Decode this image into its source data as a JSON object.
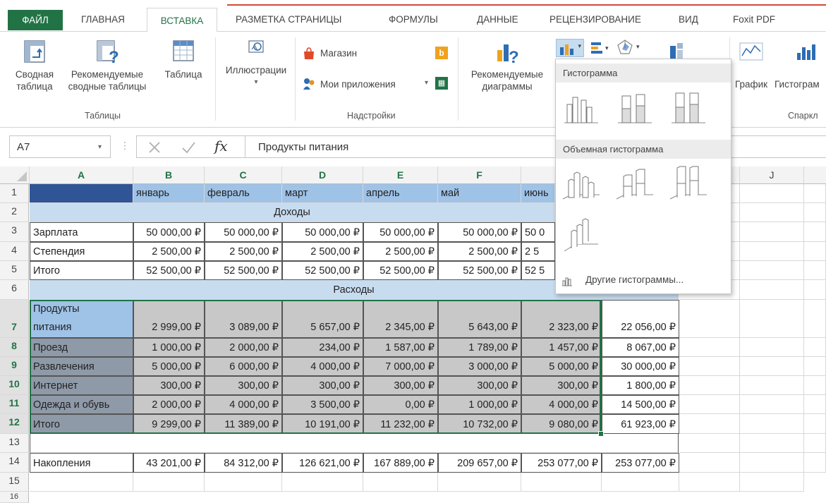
{
  "tabs": [
    "ФАЙЛ",
    "ГЛАВНАЯ",
    "ВСТАВКА",
    "РАЗМЕТКА СТРАНИЦЫ",
    "ФОРМУЛЫ",
    "ДАННЫЕ",
    "РЕЦЕНЗИРОВАНИЕ",
    "ВИД",
    "Foxit PDF"
  ],
  "ribbon": {
    "pivot": [
      "Сводная",
      "таблица"
    ],
    "recommended_pivot": [
      "Рекомендуемые",
      "сводные таблицы"
    ],
    "table": "Таблица",
    "tables_group": "Таблицы",
    "illustrations": "Иллюстрации",
    "store": "Магазин",
    "my_apps": "Мои приложения",
    "addins_group": "Надстройки",
    "recommended_charts": [
      "Рекомендуемые",
      "диаграммы"
    ],
    "chart_line": "График",
    "chart_hist": "Гистограм",
    "sparklines_group": "Спаркл"
  },
  "formula_bar": {
    "name_box": "A7",
    "fx_label": "fx",
    "value": "Продукты питания"
  },
  "columns": [
    "A",
    "B",
    "C",
    "D",
    "E",
    "F",
    "",
    "",
    "",
    "J"
  ],
  "rows": [
    "1",
    "2",
    "3",
    "4",
    "5",
    "6",
    "7",
    "8",
    "9",
    "10",
    "11",
    "12",
    "13",
    "14",
    "15",
    "16"
  ],
  "sheet": {
    "months": [
      "январь",
      "февраль",
      "март",
      "апрель",
      "май",
      "июнь"
    ],
    "income_header": "Доходы",
    "expense_header": "Расходы",
    "income": [
      {
        "label": "Зарплата",
        "values": [
          "50 000,00 ₽",
          "50 000,00 ₽",
          "50 000,00 ₽",
          "50 000,00 ₽",
          "50 000,00 ₽",
          "50 0"
        ]
      },
      {
        "label": "Степендия",
        "values": [
          "2 500,00 ₽",
          "2 500,00 ₽",
          "2 500,00 ₽",
          "2 500,00 ₽",
          "2 500,00 ₽",
          "2 5"
        ]
      },
      {
        "label": "Итого",
        "values": [
          "52 500,00 ₽",
          "52 500,00 ₽",
          "52 500,00 ₽",
          "52 500,00 ₽",
          "52 500,00 ₽",
          "52 5"
        ]
      }
    ],
    "expenses": [
      {
        "label": "Продукты",
        "label2": "питания",
        "values": [
          "2 999,00 ₽",
          "3 089,00 ₽",
          "5 657,00 ₽",
          "2 345,00 ₽",
          "5 643,00 ₽",
          "2 323,00 ₽"
        ],
        "total": "22 056,00 ₽"
      },
      {
        "label": "Проезд",
        "values": [
          "1 000,00 ₽",
          "2 000,00 ₽",
          "234,00 ₽",
          "1 587,00 ₽",
          "1 789,00 ₽",
          "1 457,00 ₽"
        ],
        "total": "8 067,00 ₽"
      },
      {
        "label": "Развлечения",
        "values": [
          "5 000,00 ₽",
          "6 000,00 ₽",
          "4 000,00 ₽",
          "7 000,00 ₽",
          "3 000,00 ₽",
          "5 000,00 ₽"
        ],
        "total": "30 000,00 ₽"
      },
      {
        "label": "Интернет",
        "values": [
          "300,00 ₽",
          "300,00 ₽",
          "300,00 ₽",
          "300,00 ₽",
          "300,00 ₽",
          "300,00 ₽"
        ],
        "total": "1 800,00 ₽"
      },
      {
        "label": "Одежда и обувь",
        "values": [
          "2 000,00 ₽",
          "4 000,00 ₽",
          "3 500,00 ₽",
          "0,00 ₽",
          "1 000,00 ₽",
          "4 000,00 ₽"
        ],
        "total": "14 500,00 ₽"
      },
      {
        "label": "Итого",
        "values": [
          "9 299,00 ₽",
          "11 389,00 ₽",
          "10 191,00 ₽",
          "11 232,00 ₽",
          "10 732,00 ₽",
          "9 080,00 ₽"
        ],
        "total": "61 923,00 ₽"
      }
    ],
    "savings": {
      "label": "Накопления",
      "values": [
        "43 201,00 ₽",
        "84 312,00 ₽",
        "126 621,00 ₽",
        "167 889,00 ₽",
        "209 657,00 ₽",
        "253 077,00 ₽",
        "253 077,00 ₽"
      ]
    }
  },
  "dropdown": {
    "section1": "Гистограмма",
    "section2": "Объемная гистограмма",
    "more": "Другие гистограммы..."
  },
  "colors": {
    "excel_green": "#217346",
    "accent_red": "#d04a3a",
    "header_blue": "#9fc2e7"
  }
}
